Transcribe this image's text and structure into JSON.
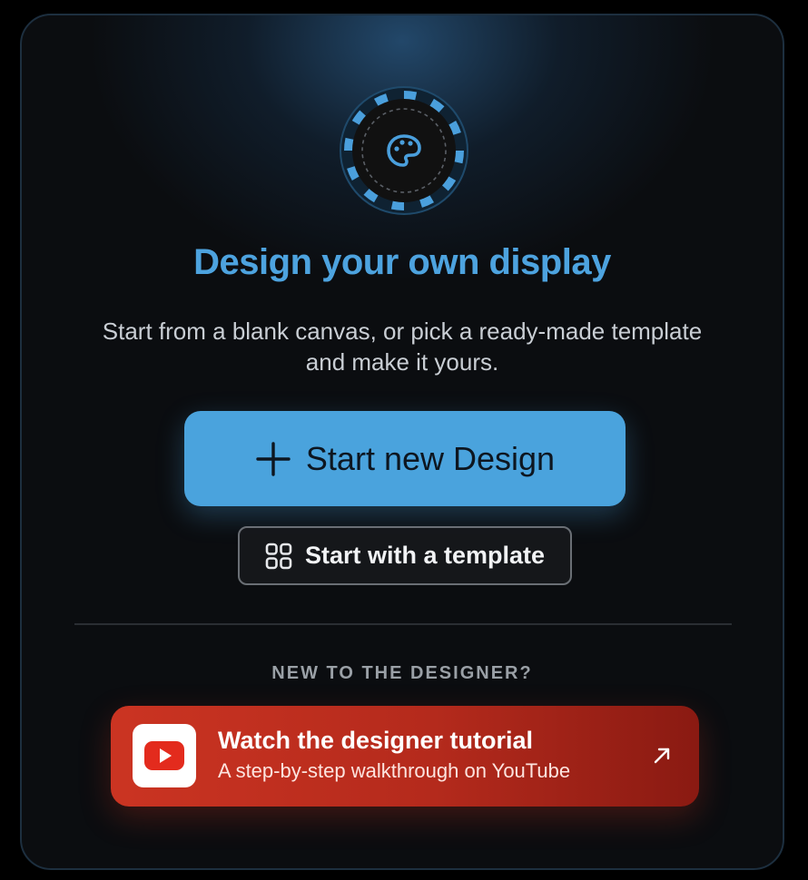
{
  "hero": {
    "icon": "palette-icon",
    "accent_color": "#4da3df"
  },
  "title": "Design your own display",
  "subtitle": "Start from a blank canvas, or pick a ready-made template and make it yours.",
  "primary_button": {
    "label": "Start new Design",
    "icon": "plus-icon",
    "color": "#4aa3dd"
  },
  "secondary_button": {
    "label": "Start with a template",
    "icon": "grid-icon"
  },
  "tutorial_section": {
    "label": "NEW TO THE DESIGNER?",
    "card": {
      "title": "Watch the designer tutorial",
      "subtitle": "A step-by-step walkthrough on YouTube",
      "logo_icon": "youtube-icon",
      "action_icon": "external-link-arrow-icon",
      "color": "#cb3422"
    }
  }
}
